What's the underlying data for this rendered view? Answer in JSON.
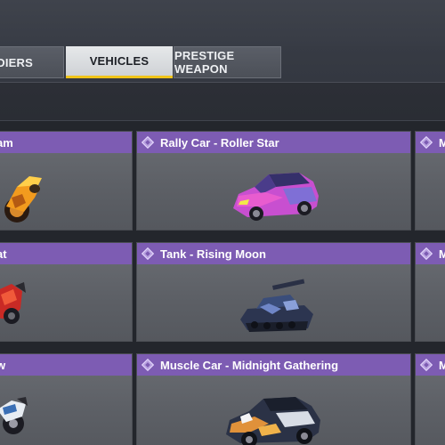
{
  "tabs": [
    {
      "label": "OLDIERS",
      "active": false
    },
    {
      "label": "VEHICLES",
      "active": true
    },
    {
      "label": "PRESTIGE WEAPON",
      "active": false
    }
  ],
  "colors": {
    "header_purple": "#7d5cb3",
    "active_tab_underline": "#f0c419",
    "card_gray": "#62656b"
  },
  "cards": [
    {
      "title": "am",
      "icon": "rarity-diamond-icon"
    },
    {
      "title": "Rally Car - Roller Star",
      "icon": "rarity-diamond-icon"
    },
    {
      "title": "M",
      "icon": "rarity-diamond-icon"
    },
    {
      "title": "at",
      "icon": "rarity-diamond-icon"
    },
    {
      "title": "Tank - Rising Moon",
      "icon": "rarity-diamond-icon"
    },
    {
      "title": "M",
      "icon": "rarity-diamond-icon"
    },
    {
      "title": "w",
      "icon": "rarity-diamond-icon"
    },
    {
      "title": "Muscle Car - Midnight Gathering",
      "icon": "rarity-diamond-icon"
    },
    {
      "title": "M",
      "icon": "rarity-diamond-icon"
    }
  ]
}
